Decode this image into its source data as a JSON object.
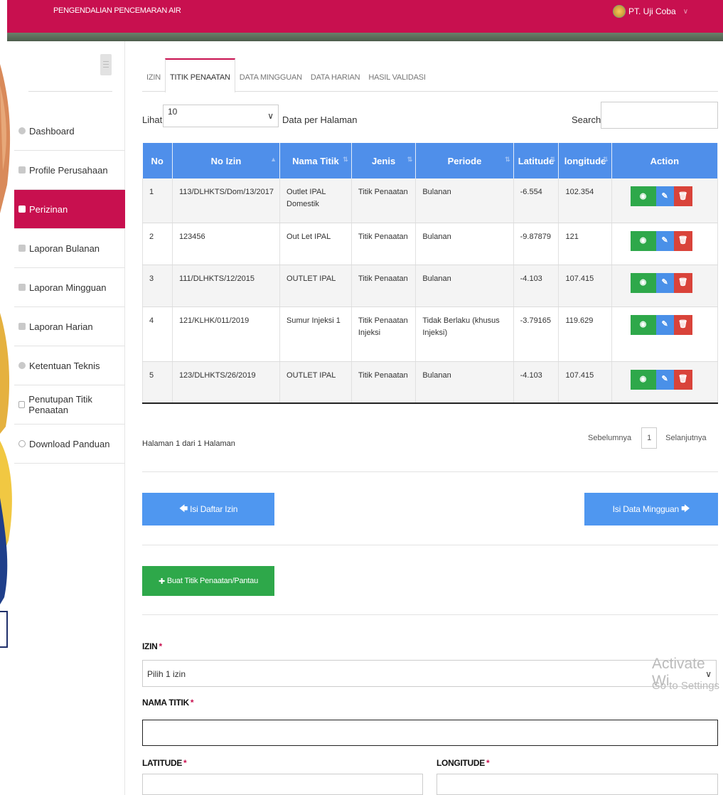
{
  "app": {
    "title": "PENGENDALIAN PENCEMARAN AIR",
    "user_name": "PT. Uji Coba",
    "user_caret": "∨"
  },
  "sidebar": {
    "items": [
      {
        "label": "Dashboard",
        "icon": "dashboard-icon",
        "active": false
      },
      {
        "label": "Profile Perusahaan",
        "icon": "building-icon",
        "active": false
      },
      {
        "label": "Perizinan",
        "icon": "checkbox-icon",
        "active": true
      },
      {
        "label": "Laporan Bulanan",
        "icon": "book-icon",
        "active": false
      },
      {
        "label": "Laporan Mingguan",
        "icon": "book-icon",
        "active": false
      },
      {
        "label": "Laporan Harian",
        "icon": "book-icon",
        "active": false
      },
      {
        "label": "Ketentuan Teknis",
        "icon": "gears-icon",
        "active": false
      },
      {
        "label": "Penutupan Titik Penaatan",
        "icon": "check-square-icon",
        "active": false
      },
      {
        "label": "Download Panduan",
        "icon": "download-icon",
        "active": false
      }
    ]
  },
  "tabs": [
    {
      "label": "IZIN",
      "active": false
    },
    {
      "label": "TITIK PENAATAN",
      "active": true
    },
    {
      "label": "DATA MINGGUAN",
      "active": false
    },
    {
      "label": "DATA HARIAN",
      "active": false
    },
    {
      "label": "HASIL VALIDASI",
      "active": false
    }
  ],
  "table_controls": {
    "lihat_label": "Lihat",
    "page_size": "10",
    "page_size_suffix": "Data per Halaman",
    "search_label": "Search:",
    "search_value": ""
  },
  "table": {
    "columns": [
      "No",
      "No Izin",
      "Nama Titik",
      "Jenis",
      "Periode",
      "Latitude",
      "longitude",
      "Action"
    ],
    "rows": [
      {
        "no": "1",
        "no_izin": "113/DLHKTS/Dom/13/2017",
        "nama_titik": "Outlet IPAL Domestik",
        "jenis": "Titik Penaatan",
        "periode": "Bulanan",
        "latitude": "-6.554",
        "longitude": "102.354"
      },
      {
        "no": "2",
        "no_izin": "123456",
        "nama_titik": "Out Let IPAL",
        "jenis": "Titik Penaatan",
        "periode": "Bulanan",
        "latitude": "-9.87879",
        "longitude": "121"
      },
      {
        "no": "3",
        "no_izin": "111/DLHKTS/12/2015",
        "nama_titik": "OUTLET IPAL",
        "jenis": "Titik Penaatan",
        "periode": "Bulanan",
        "latitude": "-4.103",
        "longitude": "107.415"
      },
      {
        "no": "4",
        "no_izin": "121/KLHK/011/2019",
        "nama_titik": "Sumur Injeksi 1",
        "jenis": "Titik Penaatan Injeksi",
        "periode": "Tidak Berlaku (khusus Injeksi)",
        "latitude": "-3.79165",
        "longitude": "119.629"
      },
      {
        "no": "5",
        "no_izin": "123/DLHKTS/26/2019",
        "nama_titik": "OUTLET IPAL",
        "jenis": "Titik Penaatan",
        "periode": "Bulanan",
        "latitude": "-4.103",
        "longitude": "107.415"
      }
    ]
  },
  "pagination": {
    "info": "Halaman 1 dari 1 Halaman",
    "prev_label": "Sebelumnya",
    "current_page": "1",
    "next_label": "Selanjutnya"
  },
  "buttons": {
    "prev_step": "Isi Daftar Izin",
    "next_step": "Isi Data Mingguan",
    "add_point": "Buat Titik Penaatan/Pantau"
  },
  "form": {
    "izin_label": "IZIN",
    "izin_placeholder": "Pilih 1 izin",
    "nama_titik_label": "NAMA TITIK",
    "latitude_label": "LATITUDE",
    "longitude_label": "LONGITUDE",
    "required_mark": "*"
  },
  "watermark": {
    "line1": "Activate Wi",
    "line2": "Go to Settings"
  },
  "colors": {
    "brand": "#c8104f",
    "table_header": "#4f8fea",
    "view_button": "#2ea84a",
    "edit_button": "#4a90e8",
    "delete_button": "#d9433a"
  }
}
